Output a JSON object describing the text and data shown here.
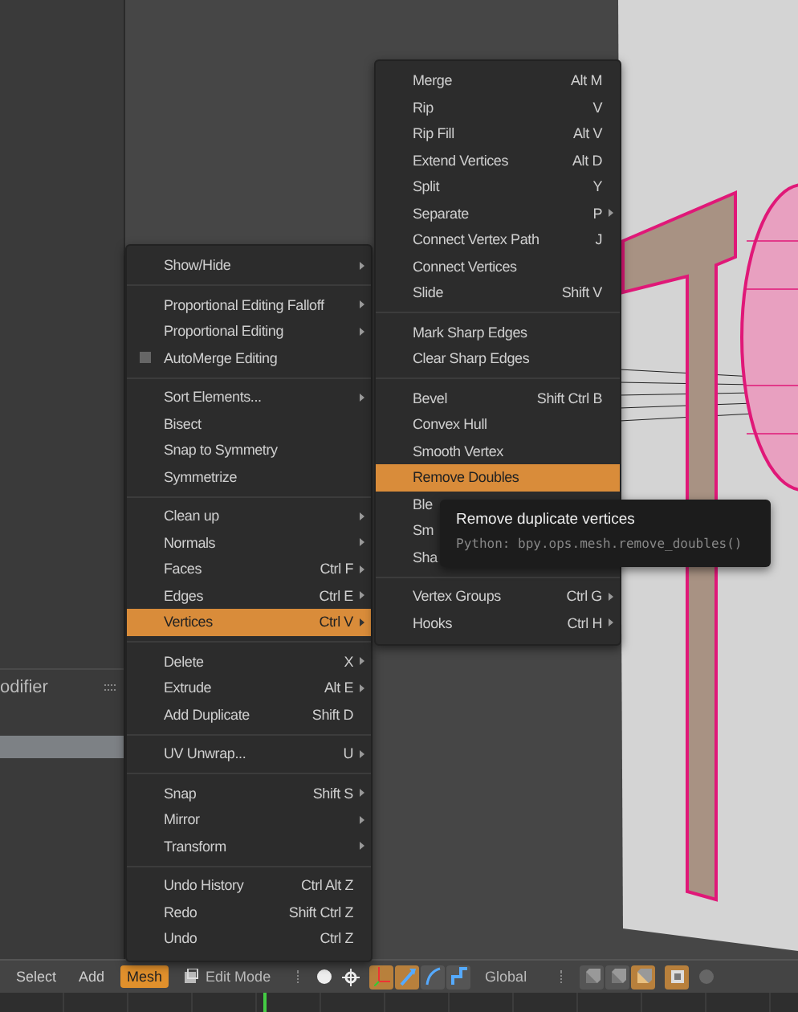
{
  "properties_panel": {
    "heading": "odifier"
  },
  "mesh_menu": {
    "sections": [
      [
        {
          "label": "Show/Hide",
          "submenu": true,
          "selected": false,
          "kind": "item"
        }
      ],
      [
        {
          "label": "Proportional Editing Falloff",
          "submenu": true,
          "selected": false,
          "kind": "item"
        },
        {
          "label": "Proportional Editing",
          "submenu": true,
          "selected": false,
          "kind": "item"
        },
        {
          "label": "AutoMerge Editing",
          "submenu": false,
          "selected": false,
          "kind": "checkbox",
          "checked": false
        }
      ],
      [
        {
          "label": "Sort Elements...",
          "submenu": true,
          "selected": false,
          "kind": "item"
        },
        {
          "label": "Bisect",
          "submenu": false,
          "selected": false,
          "kind": "item"
        },
        {
          "label": "Snap to Symmetry",
          "submenu": false,
          "selected": false,
          "kind": "item"
        },
        {
          "label": "Symmetrize",
          "submenu": false,
          "selected": false,
          "kind": "item"
        }
      ],
      [
        {
          "label": "Clean up",
          "submenu": true,
          "selected": false,
          "kind": "item"
        },
        {
          "label": "Normals",
          "submenu": true,
          "selected": false,
          "kind": "item"
        },
        {
          "label": "Faces",
          "shortcut": "Ctrl F",
          "submenu": true,
          "selected": false,
          "kind": "item"
        },
        {
          "label": "Edges",
          "shortcut": "Ctrl E",
          "submenu": true,
          "selected": false,
          "kind": "item"
        },
        {
          "label": "Vertices",
          "shortcut": "Ctrl V",
          "submenu": true,
          "selected": true,
          "kind": "item"
        }
      ],
      [
        {
          "label": "Delete",
          "shortcut": "X",
          "submenu": true,
          "selected": false,
          "kind": "item"
        },
        {
          "label": "Extrude",
          "shortcut": "Alt E",
          "submenu": true,
          "selected": false,
          "kind": "item"
        },
        {
          "label": "Add Duplicate",
          "shortcut": "Shift D",
          "submenu": false,
          "selected": false,
          "kind": "item"
        }
      ],
      [
        {
          "label": "UV Unwrap...",
          "shortcut": "U",
          "submenu": true,
          "selected": false,
          "kind": "item"
        }
      ],
      [
        {
          "label": "Snap",
          "shortcut": "Shift S",
          "submenu": true,
          "selected": false,
          "kind": "item"
        },
        {
          "label": "Mirror",
          "submenu": true,
          "selected": false,
          "kind": "item"
        },
        {
          "label": "Transform",
          "submenu": true,
          "selected": false,
          "kind": "item"
        }
      ],
      [
        {
          "label": "Undo History",
          "shortcut": "Ctrl Alt Z",
          "submenu": false,
          "selected": false,
          "kind": "item"
        },
        {
          "label": "Redo",
          "shortcut": "Shift Ctrl Z",
          "submenu": false,
          "selected": false,
          "kind": "item"
        },
        {
          "label": "Undo",
          "shortcut": "Ctrl Z",
          "submenu": false,
          "selected": false,
          "kind": "item"
        }
      ]
    ]
  },
  "vertices_menu": {
    "sections": [
      [
        {
          "label": "Merge",
          "shortcut": "Alt M",
          "submenu": false,
          "selected": false
        },
        {
          "label": "Rip",
          "shortcut": "V",
          "submenu": false,
          "selected": false
        },
        {
          "label": "Rip Fill",
          "shortcut": "Alt V",
          "submenu": false,
          "selected": false
        },
        {
          "label": "Extend Vertices",
          "shortcut": "Alt D",
          "submenu": false,
          "selected": false
        },
        {
          "label": "Split",
          "shortcut": "Y",
          "submenu": false,
          "selected": false
        },
        {
          "label": "Separate",
          "shortcut": "P",
          "submenu": true,
          "selected": false
        },
        {
          "label": "Connect Vertex Path",
          "shortcut": "J",
          "submenu": false,
          "selected": false
        },
        {
          "label": "Connect Vertices",
          "submenu": false,
          "selected": false
        },
        {
          "label": "Slide",
          "shortcut": "Shift V",
          "submenu": false,
          "selected": false
        }
      ],
      [
        {
          "label": "Mark Sharp Edges",
          "submenu": false,
          "selected": false
        },
        {
          "label": "Clear Sharp Edges",
          "submenu": false,
          "selected": false
        }
      ],
      [
        {
          "label": "Bevel",
          "shortcut": "Shift Ctrl B",
          "submenu": false,
          "selected": false
        },
        {
          "label": "Convex Hull",
          "submenu": false,
          "selected": false
        },
        {
          "label": "Smooth Vertex",
          "submenu": false,
          "selected": false
        },
        {
          "label": "Remove Doubles",
          "submenu": false,
          "selected": true
        },
        {
          "label": "Ble",
          "submenu": false,
          "selected": false
        },
        {
          "label": "Sm",
          "submenu": false,
          "selected": false
        },
        {
          "label": "Sha",
          "submenu": false,
          "selected": false
        }
      ],
      [
        {
          "label": "Vertex Groups",
          "shortcut": "Ctrl G",
          "submenu": true,
          "selected": false
        },
        {
          "label": "Hooks",
          "shortcut": "Ctrl H",
          "submenu": true,
          "selected": false
        }
      ]
    ]
  },
  "tooltip": {
    "title": "Remove duplicate vertices",
    "python": "Python: bpy.ops.mesh.remove_doubles()"
  },
  "header": {
    "menus": [
      {
        "label": "Select",
        "selected": false
      },
      {
        "label": "Add",
        "selected": false
      },
      {
        "label": "Mesh",
        "selected": true
      }
    ],
    "mode": "Edit Mode",
    "orientation": "Global",
    "tools": [
      {
        "kind": "manipulator",
        "on": true
      },
      {
        "kind": "translate",
        "on": true
      },
      {
        "kind": "rotate",
        "on": false
      },
      {
        "kind": "scale",
        "on": false
      }
    ],
    "select_modes": [
      {
        "kind": "vertex",
        "on": false
      },
      {
        "kind": "edge",
        "on": false
      },
      {
        "kind": "face",
        "on": true
      }
    ],
    "occlude": {
      "on": true
    }
  }
}
